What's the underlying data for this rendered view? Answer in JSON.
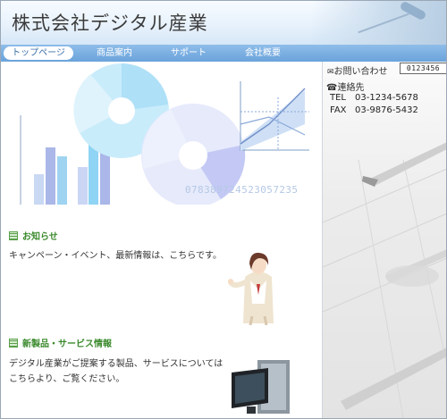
{
  "header": {
    "title": "株式会社デジタル産業"
  },
  "nav": {
    "items": [
      {
        "label": "トップページ",
        "active": true
      },
      {
        "label": "商品案内"
      },
      {
        "label": "サポート"
      },
      {
        "label": "会社概要"
      }
    ]
  },
  "hero": {
    "number_text": "078389724523057235"
  },
  "sections": [
    {
      "title": "お知らせ",
      "lines": [
        "キャンペーン・イベント、最新情報は、こちらです。"
      ]
    },
    {
      "title": "新製品・サービス情報",
      "lines": [
        "デジタル産業がご提案する製品、サービスについては",
        "こちらより、ご覧ください。"
      ]
    }
  ],
  "sidebar": {
    "contact_heading": "お問い合わせ",
    "counter": "0123456",
    "contact_label": "連絡先",
    "tel_key": "TEL",
    "tel_value": "03-1234-5678",
    "fax_key": "FAX",
    "fax_value": "03-9876-5432"
  },
  "colors": {
    "nav": "#6aa3db",
    "section_title": "#3c8a2e"
  }
}
